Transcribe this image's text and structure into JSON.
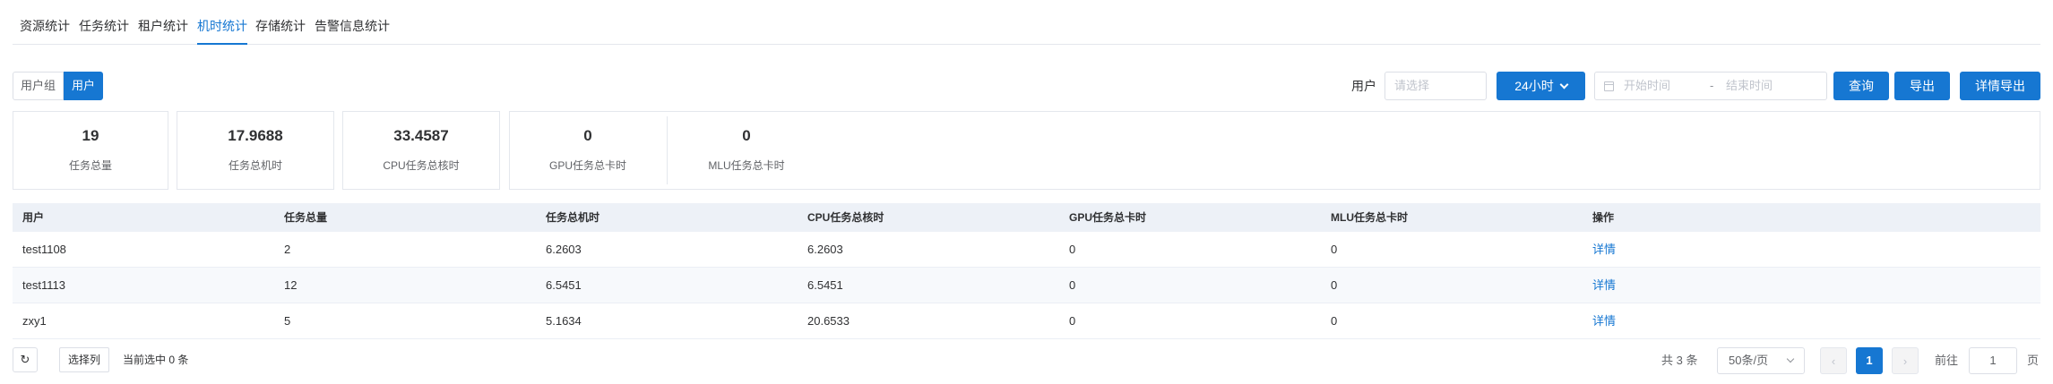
{
  "tabs": [
    {
      "label": "资源统计"
    },
    {
      "label": "任务统计"
    },
    {
      "label": "租户统计"
    },
    {
      "label": "机时统计",
      "active": true
    },
    {
      "label": "存储统计"
    },
    {
      "label": "告警信息统计"
    }
  ],
  "toggle": {
    "user_group": "用户组",
    "user": "用户",
    "selected": "用户"
  },
  "filters": {
    "user_label": "用户",
    "user_placeholder": "请选择",
    "range_label": "24小时",
    "start_placeholder": "开始时间",
    "separator": "-",
    "end_placeholder": "结束时间",
    "query_label": "查询",
    "export_label": "导出",
    "detail_export_label": "详情导出"
  },
  "summary": [
    {
      "value": "19",
      "label": "任务总量"
    },
    {
      "value": "17.9688",
      "label": "任务总机时"
    },
    {
      "value": "33.4587",
      "label": "CPU任务总核时"
    },
    {
      "value": "0",
      "label": "GPU任务总卡时"
    },
    {
      "value": "0",
      "label": "MLU任务总卡时"
    }
  ],
  "table": {
    "headers": [
      "用户",
      "任务总量",
      "任务总机时",
      "CPU任务总核时",
      "GPU任务总卡时",
      "MLU任务总卡时",
      "操作"
    ],
    "rows": [
      [
        "test1108",
        "2",
        "6.2603",
        "6.2603",
        "0",
        "0",
        "详情"
      ],
      [
        "test1113",
        "12",
        "6.5451",
        "6.5451",
        "0",
        "0",
        "详情"
      ],
      [
        "zxy1",
        "5",
        "5.1634",
        "20.6533",
        "0",
        "0",
        "详情"
      ]
    ]
  },
  "footer": {
    "select_columns": "选择列",
    "selection_info": "当前选中 0 条",
    "total": "共 3 条",
    "page_size": "50条/页",
    "prev": "‹",
    "current_page": "1",
    "next": "›",
    "goto_label": "前往",
    "goto_value": "1",
    "goto_unit": "页"
  },
  "colors": {
    "primary": "#1677d2",
    "header_bg": "#edf1f7",
    "border": "#e4e7ed"
  }
}
